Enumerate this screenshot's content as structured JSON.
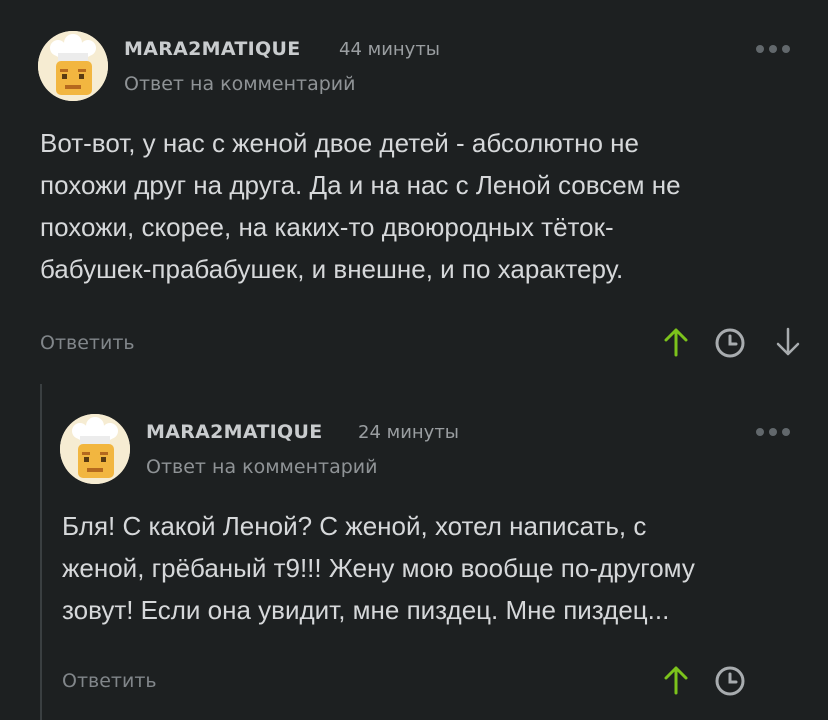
{
  "comments": [
    {
      "username": "MARA2MATIQUE",
      "time": "44 минуты",
      "reply_to": "Ответ на комментарий",
      "lines": [
        "Вот-вот, у нас с женой двое детей - абсолютно не",
        "похожи друг на друга. Да и на нас с Леной совсем не",
        "похожи, скорее, на каких-то двоюродных тёток-",
        "бабушек-прабабушек, и внешне, и по характеру."
      ],
      "reply_label": "Ответить",
      "icons": [
        "upvote-arrow-icon",
        "clock-icon",
        "downvote-arrow-icon"
      ]
    },
    {
      "username": "MARA2MATIQUE",
      "time": "24 минуты",
      "reply_to": "Ответ на комментарий",
      "lines": [
        "Бля! С какой Леной? С женой, хотел написать, с",
        "женой, грёбаный т9!!! Жену мою вообще по-другому",
        "зовут! Если она увидит, мне пиздец. Мне пиздец..."
      ],
      "reply_label": "Ответить",
      "icons": [
        "upvote-arrow-icon",
        "clock-icon"
      ]
    }
  ],
  "colors": {
    "background": "#1d2021",
    "upvote": "#7cc31c",
    "text": "#d6d8da",
    "muted": "#8f9396"
  }
}
